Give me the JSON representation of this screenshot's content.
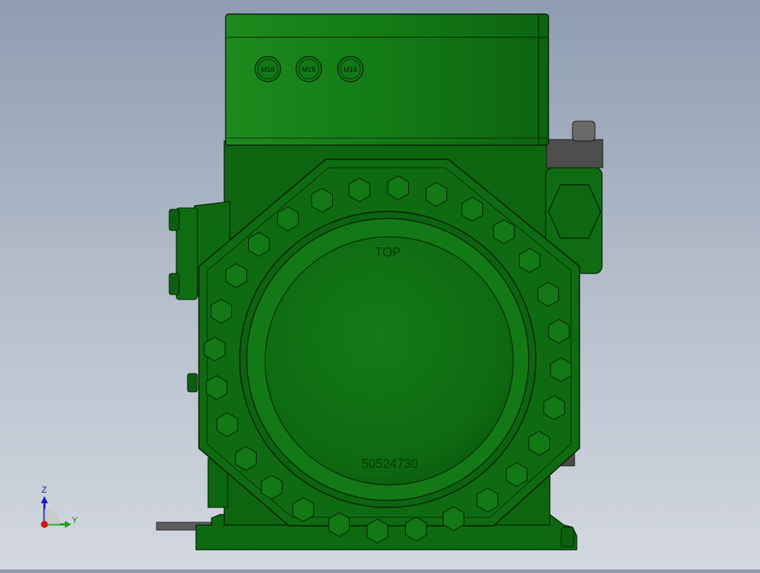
{
  "model": {
    "terminal_box_labels": [
      "M16",
      "M16",
      "M16"
    ],
    "cover_text_top": "TOP",
    "cover_part_number": "50524730"
  },
  "triad": {
    "z_label": "Z",
    "y_label": "Y"
  },
  "colors": {
    "body": "#0f6b12",
    "body_light": "#1c8a1c",
    "body_dark": "#07450a",
    "edge": "#021a03",
    "steel": "#5a5a5a",
    "axis_z": "#1a1acc",
    "axis_y": "#1aa01a",
    "axis_x": "#cc1a1a"
  }
}
